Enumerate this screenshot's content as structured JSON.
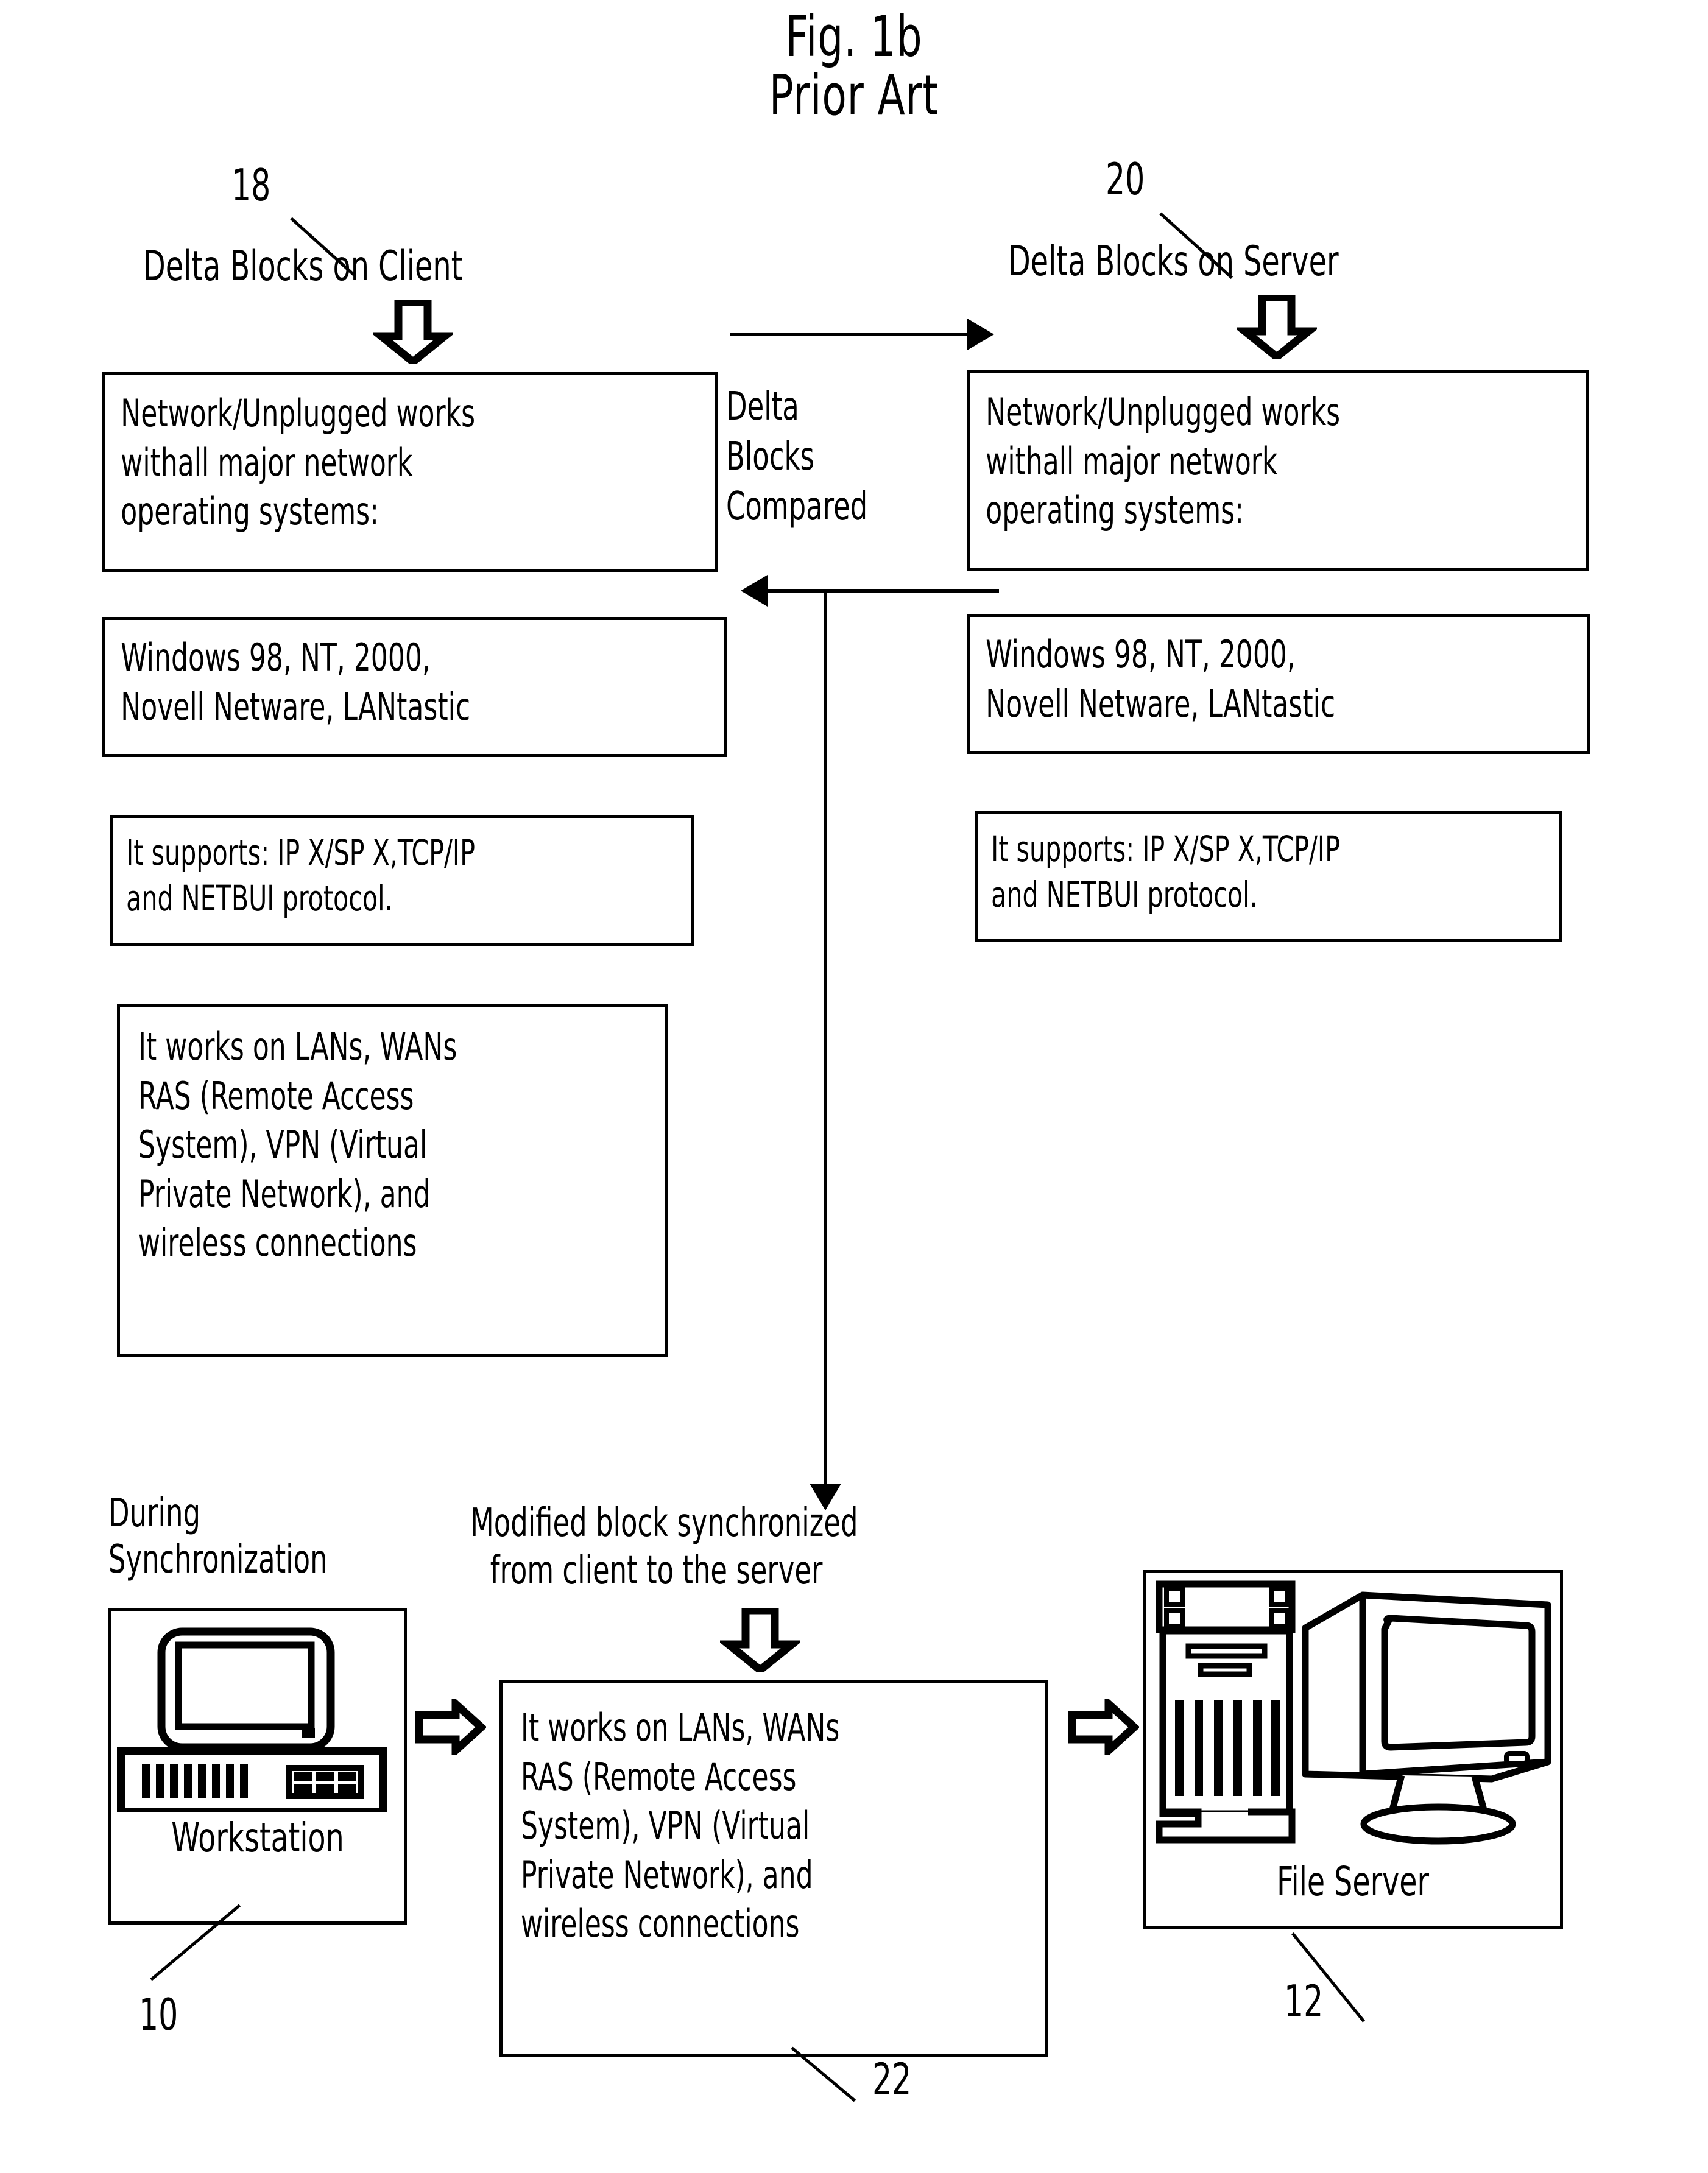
{
  "figure": {
    "title": "Fig. 1b",
    "subtitle": "Prior Art"
  },
  "client_column": {
    "ref_number": "18",
    "heading": "Delta Blocks on Client",
    "boxes": [
      {
        "ref": "client-os-box",
        "lines": [
          "Network/Unplugged works",
          "withall major network",
          "operating systems:"
        ]
      },
      {
        "ref": "client-platforms-box",
        "lines": [
          "Windows 98, NT, 2000,",
          "Novell Netware, LANtastic"
        ]
      },
      {
        "ref": "client-protocols-box",
        "lines": [
          "It supports: IP X/SP X,TCP/IP",
          "and NETBUI protocol."
        ]
      },
      {
        "ref": "client-connectivity-box",
        "lines": [
          "It works on LANs, WANs",
          "RAS (Remote Access",
          "System), VPN (Virtual",
          "Private Network), and",
          "wireless connections"
        ]
      }
    ]
  },
  "server_column": {
    "ref_number": "20",
    "heading": "Delta Blocks on Server",
    "boxes": [
      {
        "ref": "server-os-box",
        "lines": [
          "Network/Unplugged works",
          "withall major network",
          "operating systems:"
        ]
      },
      {
        "ref": "server-platforms-box",
        "lines": [
          "Windows 98, NT, 2000,",
          "Novell Netware, LANtastic"
        ]
      },
      {
        "ref": "server-protocols-box",
        "lines": [
          "It supports: IP X/SP X,TCP/IP",
          "and NETBUI protocol."
        ]
      }
    ]
  },
  "middle_label": {
    "lines": [
      "Delta",
      "Blocks",
      "Compared"
    ]
  },
  "sync_section": {
    "phase_label_lines": [
      "During",
      "Synchronization"
    ],
    "flow_label_lines": [
      "Modified block synchronized",
      "from client to the server"
    ],
    "workstation": {
      "caption": "Workstation",
      "ref_number": "10"
    },
    "sync_box": {
      "ref_number": "22",
      "lines": [
        "It works on LANs, WANs",
        "RAS (Remote Access",
        "System), VPN (Virtual",
        "Private Network), and",
        "wireless connections"
      ]
    },
    "file_server": {
      "caption": "File Server",
      "ref_number": "12"
    }
  },
  "colors": {
    "ink": "#000000",
    "paper": "#ffffff"
  }
}
